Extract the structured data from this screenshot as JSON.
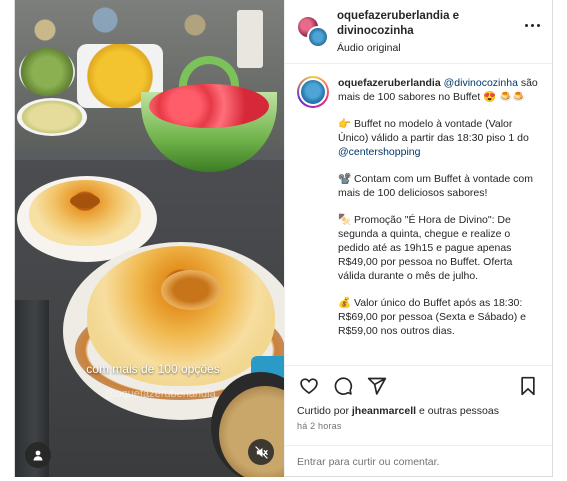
{
  "header": {
    "account_primary": "oquefazeruberlandia",
    "connector": "e",
    "account_secondary": "divinocozinha",
    "audio_label": "Áudio original"
  },
  "media": {
    "overlay_caption": "com mais de 100 opções",
    "watermark": "@oquefazeruberlandia"
  },
  "caption": {
    "user": "oquefazeruberlandia",
    "mention_1": "@divinocozinha",
    "line_1": "são mais de 100 sabores no Buffet 😍",
    "line_1_emoji_tail": "🍮🍮",
    "para_1_emoji": "👉",
    "para_1_text": "Buffet no modelo à vontade (Valor Único) válido a partir das 18:30 piso 1 do",
    "para_1_mention": "@centershopping",
    "para_2_emoji": "📽️",
    "para_2_text": "Contam com um Buffet à vontade com mais de 100 deliciosos sabores!",
    "para_3_emoji": "🍢",
    "para_3_text": "Promoção \"É Hora de Divino\": De segunda a quinta, chegue e realize o pedido até as 19h15 e pague apenas R$49,00 por pessoa no Buffet. Oferta válida durante o mês de julho.",
    "para_4_emoji": "💰",
    "para_4_text": "Valor único do Buffet após as 18:30: R$69,00 por pessoa (Sexta e Sábado) e R$59,00 nos outros dias."
  },
  "engagement": {
    "liked_prefix": "Curtido por",
    "liked_user": "jheanmarcell",
    "liked_suffix": "e outras pessoas",
    "time_ago": "há 2 horas"
  },
  "comment": {
    "login_link": "Entrar",
    "rest": "para curtir ou comentar."
  },
  "icons": [
    "more-horizontal-icon",
    "heart-icon",
    "comment-icon",
    "share-icon",
    "bookmark-icon",
    "user-tag-icon",
    "mute-icon"
  ],
  "colors": {
    "link": "#00376b",
    "text": "#262626",
    "muted": "#737373",
    "border": "#dbdbdb"
  }
}
